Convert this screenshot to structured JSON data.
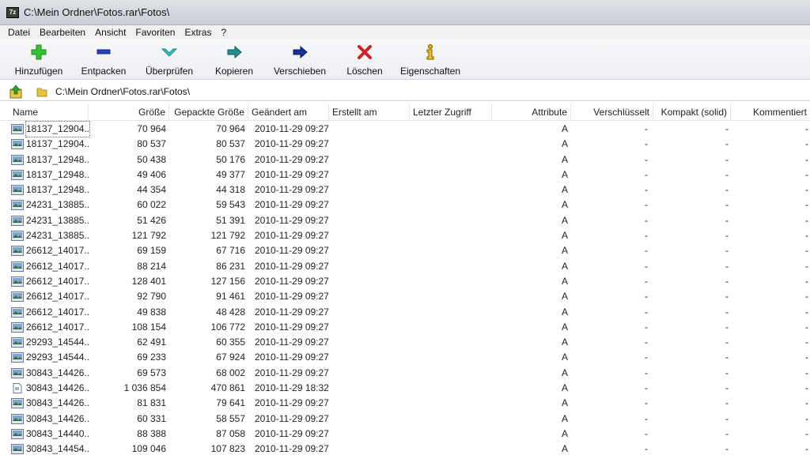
{
  "window": {
    "title": "C:\\Mein Ordner\\Fotos.rar\\Fotos\\",
    "app_icon_text": "7z"
  },
  "menu": [
    "Datei",
    "Bearbeiten",
    "Ansicht",
    "Favoriten",
    "Extras",
    "?"
  ],
  "toolbar": {
    "add": "Hinzufügen",
    "extract": "Entpacken",
    "test": "Überprüfen",
    "copy": "Kopieren",
    "move": "Verschieben",
    "delete": "Löschen",
    "properties": "Eigenschaften"
  },
  "address": {
    "path": "C:\\Mein Ordner\\Fotos.rar\\Fotos\\"
  },
  "columns": {
    "name": "Name",
    "size": "Größe",
    "packed": "Gepackte Größe",
    "modified": "Geändert am",
    "created": "Erstellt am",
    "accessed": "Letzter Zugriff",
    "attributes": "Attribute",
    "encrypted": "Verschlüsselt",
    "solid": "Kompakt (solid)",
    "comment": "Kommentiert"
  },
  "rows": [
    {
      "name": "18137_12904...",
      "size": "70 964",
      "packed": "70 964",
      "modified": "2010-11-29 09:27",
      "attr": "A",
      "enc": "-",
      "solid": "-",
      "comment": "-",
      "icon": "image-file-icon"
    },
    {
      "name": "18137_12904...",
      "size": "80 537",
      "packed": "80 537",
      "modified": "2010-11-29 09:27",
      "attr": "A",
      "enc": "-",
      "solid": "-",
      "comment": "-",
      "icon": "image-file-icon"
    },
    {
      "name": "18137_12948...",
      "size": "50 438",
      "packed": "50 176",
      "modified": "2010-11-29 09:27",
      "attr": "A",
      "enc": "-",
      "solid": "-",
      "comment": "-",
      "icon": "image-file-icon"
    },
    {
      "name": "18137_12948...",
      "size": "49 406",
      "packed": "49 377",
      "modified": "2010-11-29 09:27",
      "attr": "A",
      "enc": "-",
      "solid": "-",
      "comment": "-",
      "icon": "image-file-icon"
    },
    {
      "name": "18137_12948...",
      "size": "44 354",
      "packed": "44 318",
      "modified": "2010-11-29 09:27",
      "attr": "A",
      "enc": "-",
      "solid": "-",
      "comment": "-",
      "icon": "image-file-icon"
    },
    {
      "name": "24231_13885...",
      "size": "60 022",
      "packed": "59 543",
      "modified": "2010-11-29 09:27",
      "attr": "A",
      "enc": "-",
      "solid": "-",
      "comment": "-",
      "icon": "image-file-icon"
    },
    {
      "name": "24231_13885...",
      "size": "51 426",
      "packed": "51 391",
      "modified": "2010-11-29 09:27",
      "attr": "A",
      "enc": "-",
      "solid": "-",
      "comment": "-",
      "icon": "image-file-icon"
    },
    {
      "name": "24231_13885...",
      "size": "121 792",
      "packed": "121 792",
      "modified": "2010-11-29 09:27",
      "attr": "A",
      "enc": "-",
      "solid": "-",
      "comment": "-",
      "icon": "image-file-icon"
    },
    {
      "name": "26612_14017...",
      "size": "69 159",
      "packed": "67 716",
      "modified": "2010-11-29 09:27",
      "attr": "A",
      "enc": "-",
      "solid": "-",
      "comment": "-",
      "icon": "image-file-icon"
    },
    {
      "name": "26612_14017...",
      "size": "88 214",
      "packed": "86 231",
      "modified": "2010-11-29 09:27",
      "attr": "A",
      "enc": "-",
      "solid": "-",
      "comment": "-",
      "icon": "image-file-icon"
    },
    {
      "name": "26612_14017...",
      "size": "128 401",
      "packed": "127 156",
      "modified": "2010-11-29 09:27",
      "attr": "A",
      "enc": "-",
      "solid": "-",
      "comment": "-",
      "icon": "image-file-icon"
    },
    {
      "name": "26612_14017...",
      "size": "92 790",
      "packed": "91 461",
      "modified": "2010-11-29 09:27",
      "attr": "A",
      "enc": "-",
      "solid": "-",
      "comment": "-",
      "icon": "image-file-icon"
    },
    {
      "name": "26612_14017...",
      "size": "49 838",
      "packed": "48 428",
      "modified": "2010-11-29 09:27",
      "attr": "A",
      "enc": "-",
      "solid": "-",
      "comment": "-",
      "icon": "image-file-icon"
    },
    {
      "name": "26612_14017...",
      "size": "108 154",
      "packed": "106 772",
      "modified": "2010-11-29 09:27",
      "attr": "A",
      "enc": "-",
      "solid": "-",
      "comment": "-",
      "icon": "image-file-icon"
    },
    {
      "name": "29293_14544...",
      "size": "62 491",
      "packed": "60 355",
      "modified": "2010-11-29 09:27",
      "attr": "A",
      "enc": "-",
      "solid": "-",
      "comment": "-",
      "icon": "image-file-icon"
    },
    {
      "name": "29293_14544...",
      "size": "69 233",
      "packed": "67 924",
      "modified": "2010-11-29 09:27",
      "attr": "A",
      "enc": "-",
      "solid": "-",
      "comment": "-",
      "icon": "image-file-icon"
    },
    {
      "name": "30843_14426...",
      "size": "69 573",
      "packed": "68 002",
      "modified": "2010-11-29 09:27",
      "attr": "A",
      "enc": "-",
      "solid": "-",
      "comment": "-",
      "icon": "image-file-icon"
    },
    {
      "name": "30843_14426...",
      "size": "1 036 854",
      "packed": "470 861",
      "modified": "2010-11-29 18:32",
      "attr": "A",
      "enc": "-",
      "solid": "-",
      "comment": "-",
      "icon": "document-file-icon"
    },
    {
      "name": "30843_14426...",
      "size": "81 831",
      "packed": "79 641",
      "modified": "2010-11-29 09:27",
      "attr": "A",
      "enc": "-",
      "solid": "-",
      "comment": "-",
      "icon": "image-file-icon"
    },
    {
      "name": "30843_14426...",
      "size": "60 331",
      "packed": "58 557",
      "modified": "2010-11-29 09:27",
      "attr": "A",
      "enc": "-",
      "solid": "-",
      "comment": "-",
      "icon": "image-file-icon"
    },
    {
      "name": "30843_14440...",
      "size": "88 388",
      "packed": "87 058",
      "modified": "2010-11-29 09:27",
      "attr": "A",
      "enc": "-",
      "solid": "-",
      "comment": "-",
      "icon": "image-file-icon"
    },
    {
      "name": "30843_14454...",
      "size": "109 046",
      "packed": "107 823",
      "modified": "2010-11-29 09:27",
      "attr": "A",
      "enc": "-",
      "solid": "-",
      "comment": "-",
      "icon": "image-file-icon"
    }
  ],
  "colors": {
    "add": "#2fbf2f",
    "extract": "#1f3fb0",
    "test": "#2cc0c0",
    "copy": "#1f8f8f",
    "move": "#1a2f9a",
    "delete": "#d12020",
    "properties": "#e0b000"
  }
}
